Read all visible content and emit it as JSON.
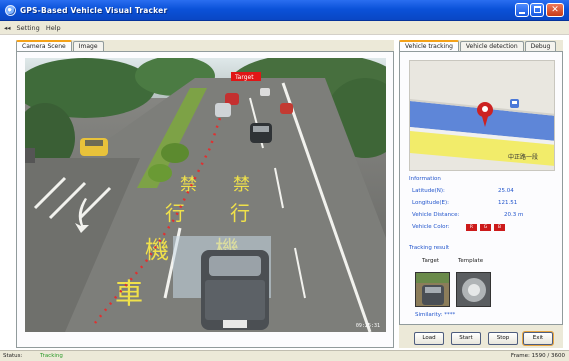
{
  "window": {
    "title": "GPS-Based Vehicle Visual Tracker"
  },
  "menu": {
    "items": [
      "◂◂",
      "Setting",
      "Help"
    ]
  },
  "left_tabs": [
    {
      "label": "Camera Scene",
      "active": true
    },
    {
      "label": "Image",
      "active": false
    }
  ],
  "video": {
    "timestamp": "09:25:31",
    "vehicle_label": "Target",
    "road_text": [
      "禁",
      "禁",
      "行",
      "行",
      "機",
      "機",
      "車"
    ]
  },
  "right_tabs": [
    {
      "label": "Vehicle tracking",
      "active": true
    },
    {
      "label": "Vehicle detection",
      "active": false
    },
    {
      "label": "Debug",
      "active": false
    }
  ],
  "map": {
    "street_label": "中正路一段"
  },
  "info": {
    "heading": "Information",
    "rows": [
      {
        "label": "Latitude(N):",
        "value": "25.04"
      },
      {
        "label": "Longitude(E):",
        "value": "121.51"
      },
      {
        "label": "Vehicle Distance:",
        "value": "20.3 m"
      }
    ],
    "badges_label": "Vehicle Color:",
    "badges": [
      "R",
      "G",
      "B"
    ]
  },
  "match": {
    "heading": "Tracking result",
    "target_label": "Target",
    "template_label": "Template",
    "similarity_label": "Similarity: ****"
  },
  "buttons": {
    "load": "Load",
    "start": "Start",
    "stop": "Stop",
    "exit": "Exit"
  },
  "status": {
    "label": "Status:",
    "value": "Tracking",
    "right": "Frame: 1590 / 3600"
  },
  "colors": {
    "titlebar": "#0b52d9",
    "accent_tab": "#f4a21a",
    "info_text": "#2255cc",
    "badge_red": "#cc1a1a",
    "map_road": "#5e86d8",
    "status_green": "#2a9a2a"
  }
}
